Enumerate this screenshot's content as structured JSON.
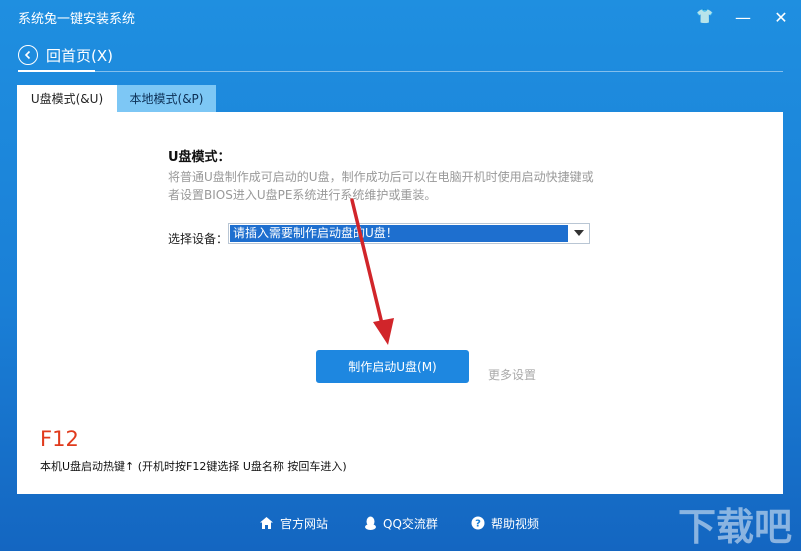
{
  "window": {
    "title": "系统兔一键安装系统",
    "controls": {
      "skin": "👕",
      "minimize": "—",
      "close": "✕"
    }
  },
  "nav": {
    "back_label": "回首页(X)"
  },
  "tabs": [
    {
      "label": "U盘模式(&U)",
      "active": true
    },
    {
      "label": "本地模式(&P)",
      "active": false
    }
  ],
  "usb_mode": {
    "title": "U盘模式：",
    "description": "将普通U盘制作成可启动的U盘，制作成功后可以在电脑开机时使用启动快捷键或者设置BIOS进入U盘PE系统进行系统维护或重装。",
    "device_label": "选择设备：",
    "device_value": "请插入需要制作启动盘的U盘！",
    "make_button": "制作启动U盘(M)",
    "more_settings": "更多设置"
  },
  "hotkey": {
    "key": "F12",
    "note": "本机U盘启动热键↑ (开机时按F12键选择 U盘名称 按回车进入)"
  },
  "footer": {
    "links": [
      {
        "label": "官方网站",
        "icon": "home-icon"
      },
      {
        "label": "QQ交流群",
        "icon": "qq-icon"
      },
      {
        "label": "帮助视频",
        "icon": "help-icon"
      }
    ]
  },
  "colors": {
    "accent": "#1e87e0",
    "hotkey_red": "#e03a1c",
    "annotation_arrow": "#d1252a"
  },
  "watermark": {
    "text": "下载吧"
  }
}
